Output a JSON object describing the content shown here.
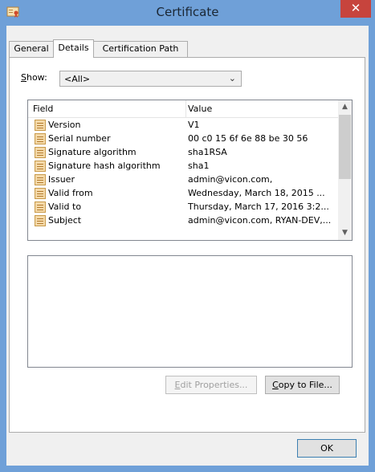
{
  "window": {
    "title": "Certificate",
    "close_symbol": "✕"
  },
  "tabs": [
    {
      "label": "General"
    },
    {
      "label": "Details"
    },
    {
      "label": "Certification Path"
    }
  ],
  "show": {
    "label_underlined": "S",
    "label_rest": "how:",
    "selected": "<All>"
  },
  "fields": {
    "columns": {
      "field": "Field",
      "value": "Value"
    },
    "rows": [
      {
        "field": "Version",
        "value": "V1"
      },
      {
        "field": "Serial number",
        "value": "00 c0 15 6f 6e 88 be 30 56"
      },
      {
        "field": "Signature algorithm",
        "value": "sha1RSA"
      },
      {
        "field": "Signature hash algorithm",
        "value": "sha1"
      },
      {
        "field": "Issuer",
        "value": "admin@vicon.com,"
      },
      {
        "field": "Valid from",
        "value": "Wednesday, March 18, 2015 ..."
      },
      {
        "field": "Valid to",
        "value": "Thursday, March 17, 2016 3:2..."
      },
      {
        "field": "Subject",
        "value": "admin@vicon.com, RYAN-DEV,..."
      }
    ]
  },
  "buttons": {
    "edit_properties_u": "E",
    "edit_properties_rest": "dit Properties...",
    "copy_to_file_u": "C",
    "copy_to_file_rest": "opy to File...",
    "ok": "OK"
  },
  "colors": {
    "titlebar": "#6fa0d8",
    "close": "#c7443d"
  }
}
